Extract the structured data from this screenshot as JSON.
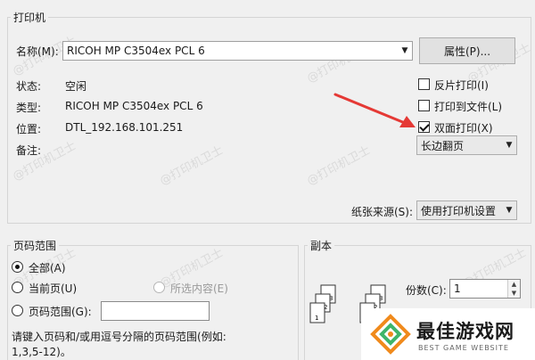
{
  "printer": {
    "group_title": "打印机",
    "name_label": "名称(M):",
    "name_value": "RICOH MP C3504ex PCL 6",
    "properties_button": "属性(P)...",
    "status_label": "状态:",
    "status_value": "空闲",
    "type_label": "类型:",
    "type_value": "RICOH MP C3504ex PCL 6",
    "location_label": "位置:",
    "location_value": "DTL_192.168.101.251",
    "comment_label": "备注:",
    "reverse_print": "反片打印(I)",
    "print_to_file": "打印到文件(L)",
    "duplex": "双面打印(X)",
    "flip_value": "长边翻页",
    "paper_source_label": "纸张来源(S):",
    "paper_source_value": "使用打印机设置"
  },
  "page_range": {
    "group_title": "页码范围",
    "all": "全部(A)",
    "current": "当前页(U)",
    "selection": "所选内容(E)",
    "pages": "页码范围(G):",
    "hint_line1": "请键入页码和/或用逗号分隔的页码范围(例如:",
    "hint_line2": "1,3,5-12)。"
  },
  "copies": {
    "group_title": "副本",
    "count_label": "份数(C):",
    "count_value": "1"
  },
  "watermark": "@打印机卫士",
  "logo": {
    "title": "最佳游戏网",
    "subtitle": "BEST GAME WEBSITE"
  },
  "colors": {
    "arrow": "#e53935",
    "logo_orange": "#f08a1c",
    "logo_green": "#3fb56a"
  }
}
